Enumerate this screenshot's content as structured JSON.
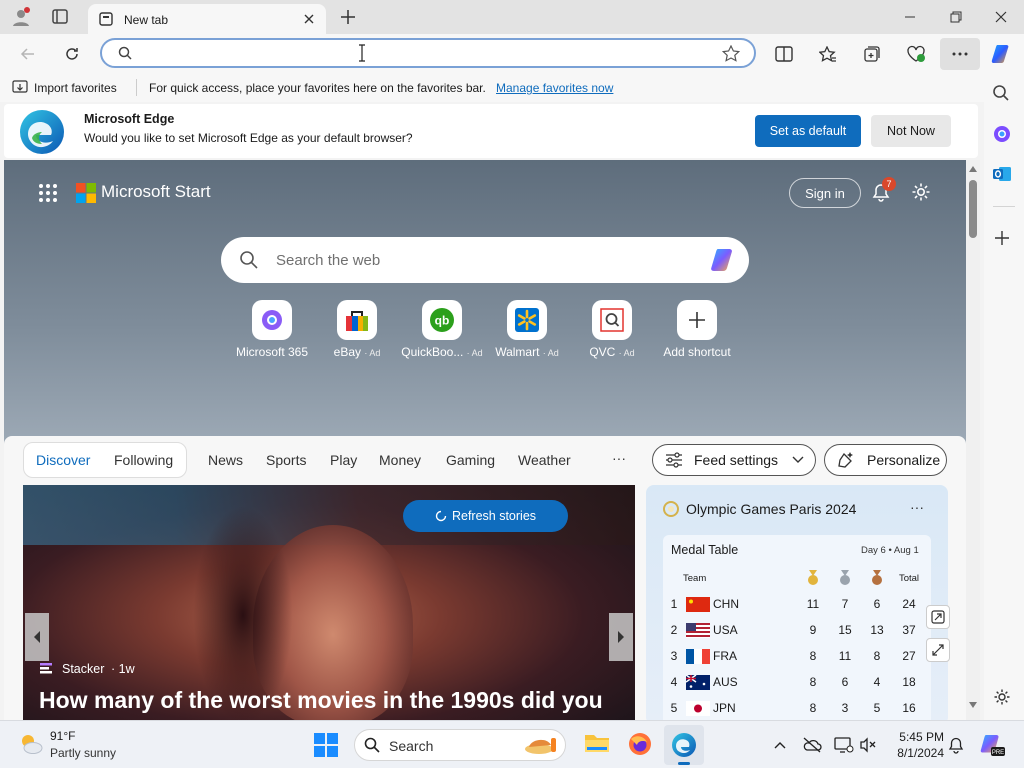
{
  "browser": {
    "tab_title": "New tab",
    "address_value": "",
    "favorites_bar": {
      "import_label": "Import favorites",
      "hint": "For quick access, place your favorites here on the favorites bar.",
      "manage_link": "Manage favorites now"
    },
    "banner": {
      "title": "Microsoft Edge",
      "message": "Would you like to set Microsoft Edge as your default browser?",
      "primary_button": "Set as default",
      "secondary_button": "Not Now"
    }
  },
  "start_page": {
    "brand": "Microsoft Start",
    "sign_in": "Sign in",
    "notification_count": "7",
    "search_placeholder": "Search the web",
    "shortcuts": [
      {
        "label": "Microsoft 365",
        "ad": ""
      },
      {
        "label": "eBay",
        "ad": "· Ad"
      },
      {
        "label": "QuickBoo...",
        "ad": "· Ad"
      },
      {
        "label": "Walmart",
        "ad": "· Ad"
      },
      {
        "label": "QVC",
        "ad": "· Ad"
      },
      {
        "label": "Add shortcut",
        "ad": ""
      }
    ],
    "feed_tabs": {
      "discover": "Discover",
      "following": "Following",
      "items": [
        "News",
        "Sports",
        "Play",
        "Money",
        "Gaming",
        "Weather"
      ],
      "more": "···"
    },
    "feed_settings": "Feed settings",
    "personalize": "Personalize",
    "story": {
      "refresh": "Refresh stories",
      "source": "Stacker",
      "age": "· 1w",
      "headline": "How many of the worst movies in the 1990s did you"
    },
    "olympics": {
      "title": "Olympic Games Paris 2024",
      "more": "···",
      "table_title": "Medal Table",
      "date": "Day 6 • Aug 1",
      "team_header": "Team",
      "total_header": "Total",
      "rows": [
        {
          "rank": "1",
          "team": "CHN",
          "gold": "11",
          "silver": "7",
          "bronze": "6",
          "total": "24"
        },
        {
          "rank": "2",
          "team": "USA",
          "gold": "9",
          "silver": "15",
          "bronze": "13",
          "total": "37"
        },
        {
          "rank": "3",
          "team": "FRA",
          "gold": "8",
          "silver": "11",
          "bronze": "8",
          "total": "27"
        },
        {
          "rank": "4",
          "team": "AUS",
          "gold": "8",
          "silver": "6",
          "bronze": "4",
          "total": "18"
        },
        {
          "rank": "5",
          "team": "JPN",
          "gold": "8",
          "silver": "3",
          "bronze": "5",
          "total": "16"
        }
      ]
    }
  },
  "taskbar": {
    "weather_temp": "91°F",
    "weather_desc": "Partly sunny",
    "search_label": "Search",
    "time": "5:45 PM",
    "date": "8/1/2024"
  },
  "colors": {
    "accent": "#0f6cbd",
    "badge": "#d9482b"
  }
}
